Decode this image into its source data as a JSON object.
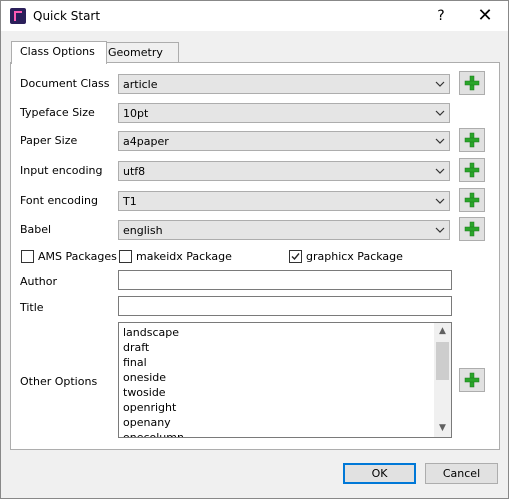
{
  "window": {
    "title": "Quick Start",
    "help_label": "?",
    "close_label": "✕"
  },
  "tabs": [
    {
      "label": "Class Options",
      "active": true
    },
    {
      "label": "Geometry",
      "active": false
    }
  ],
  "fields": {
    "document_class": {
      "label": "Document Class",
      "value": "article"
    },
    "typeface_size": {
      "label": "Typeface Size",
      "value": "10pt"
    },
    "paper_size": {
      "label": "Paper Size",
      "value": "a4paper"
    },
    "input_encoding": {
      "label": "Input encoding",
      "value": "utf8"
    },
    "font_encoding": {
      "label": "Font encoding",
      "value": "T1"
    },
    "babel": {
      "label": "Babel",
      "value": "english"
    }
  },
  "checkboxes": {
    "ams": {
      "label": "AMS Packages",
      "checked": false
    },
    "makeidx": {
      "label": "makeidx Package",
      "checked": false
    },
    "graphicx": {
      "label": "graphicx Package",
      "checked": true
    }
  },
  "author": {
    "label": "Author",
    "value": ""
  },
  "title_field": {
    "label": "Title",
    "value": ""
  },
  "other_options": {
    "label": "Other Options",
    "items": [
      "landscape",
      "draft",
      "final",
      "oneside",
      "twoside",
      "openright",
      "openany",
      "onecolumn"
    ]
  },
  "buttons": {
    "ok": "OK",
    "cancel": "Cancel"
  },
  "colors": {
    "plus_green": "#2aa52a",
    "ok_border": "#0078d7"
  },
  "icons": {
    "add": "plus-icon",
    "dropdown": "chevron-down-icon",
    "app": "texstudio-icon"
  }
}
